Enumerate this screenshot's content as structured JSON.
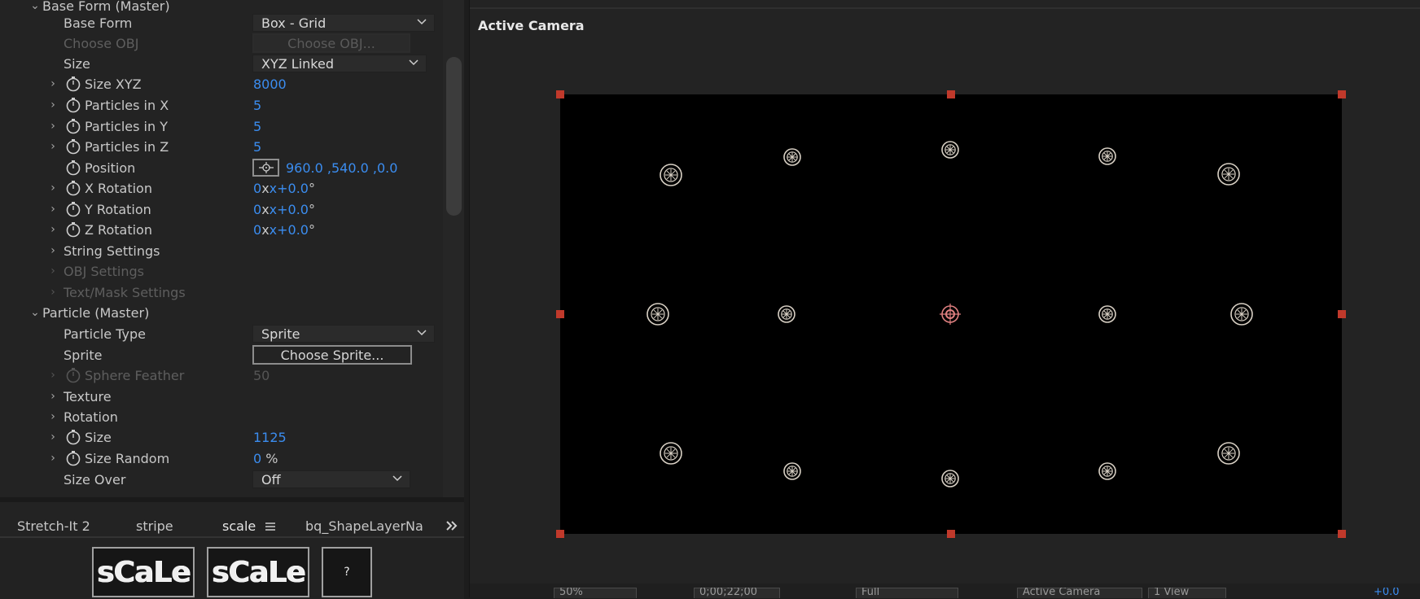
{
  "effect_controls": {
    "rows": [
      {
        "name": "Base Form (Master)"
      },
      {
        "name": "Base Form",
        "value": "Box - Grid"
      },
      {
        "name": "Choose OBJ",
        "button": "Choose OBJ..."
      },
      {
        "name": "Size",
        "value": "XYZ Linked"
      },
      {
        "name": "Size XYZ",
        "value": "8000"
      },
      {
        "name": "Particles in X",
        "value": "5"
      },
      {
        "name": "Particles in Y",
        "value": "5"
      },
      {
        "name": "Particles in Z",
        "value": "5"
      },
      {
        "name": "Position",
        "value": "960.0 ,540.0 ,0.0"
      },
      {
        "name": "X Rotation",
        "value": "0",
        "value2": "x+0.0",
        "unit": "°"
      },
      {
        "name": "Y Rotation",
        "value": "0",
        "value2": "x+0.0",
        "unit": "°"
      },
      {
        "name": "Z Rotation",
        "value": "0",
        "value2": "x+0.0",
        "unit": "°"
      },
      {
        "name": "String Settings"
      },
      {
        "name": "OBJ Settings"
      },
      {
        "name": "Text/Mask Settings"
      },
      {
        "name": "Particle (Master)"
      },
      {
        "name": "Particle Type",
        "value": "Sprite"
      },
      {
        "name": "Sprite",
        "button": "Choose Sprite..."
      },
      {
        "name": "Sphere Feather",
        "value": "50"
      },
      {
        "name": "Texture"
      },
      {
        "name": "Rotation"
      },
      {
        "name": "Size",
        "value": "1125"
      },
      {
        "name": "Size Random",
        "value": "0",
        "unit": "%"
      },
      {
        "name": "Size Over",
        "value": "Off"
      }
    ]
  },
  "bottom_panel": {
    "tabs": [
      {
        "label": "Stretch-It 2"
      },
      {
        "label": "stripe"
      },
      {
        "label": "scale",
        "active": true
      },
      {
        "label": "bq_ShapeLayerNa"
      }
    ],
    "overflow_icon": "double-chevron-right-icon",
    "buttons": [
      {
        "label": "sCaLe"
      },
      {
        "label": "sCaLe"
      },
      {
        "label": "?"
      }
    ]
  },
  "viewer": {
    "title": "Active Camera",
    "toolbar": {
      "zoom": "50%",
      "timecode": "0;00;22;00",
      "resolution": "Full",
      "view": "Active Camera",
      "views": "1 View",
      "exposure": "+0.0"
    },
    "colors": {
      "handle": "#c0392b",
      "comp_bg": "#000000",
      "particle": "#d8d0c4",
      "anchor": "#e08080"
    }
  }
}
